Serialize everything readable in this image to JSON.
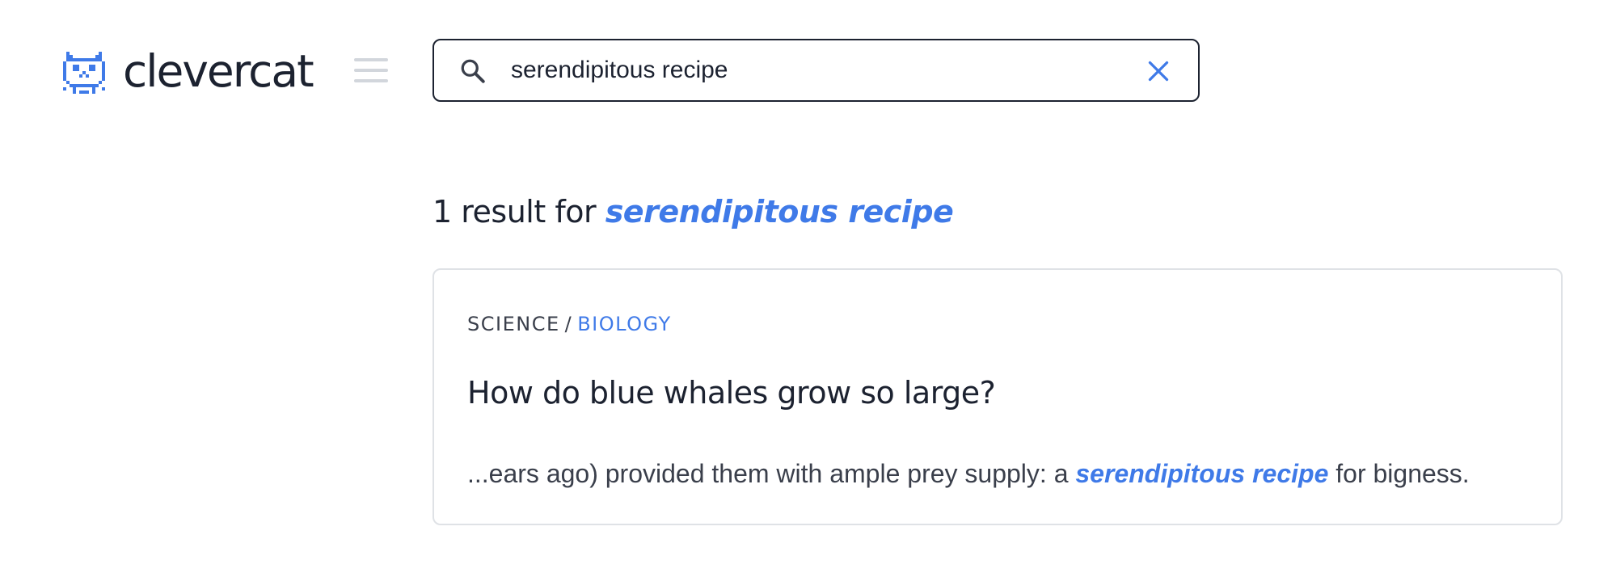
{
  "app": {
    "brand_name": "clevercat",
    "logo_icon": "cat-logo-icon",
    "menu_icon": "hamburger-menu-icon",
    "accent_color": "#3f7ae8",
    "text_color": "#1c2230"
  },
  "search": {
    "value": "serendipitous recipe",
    "search_icon": "search-icon",
    "clear_icon": "close-icon"
  },
  "results": {
    "count_text": "1 result for",
    "query": "serendipitous recipe",
    "items": [
      {
        "breadcrumb": {
          "category": "SCIENCE",
          "separator": "/",
          "subcategory": "BIOLOGY"
        },
        "title": "How do blue whales grow so large?",
        "snippet_before": "...ears ago) provided them with ample prey supply: a",
        "snippet_highlight": "serendipitous recipe",
        "snippet_after": "for bigness."
      }
    ]
  }
}
